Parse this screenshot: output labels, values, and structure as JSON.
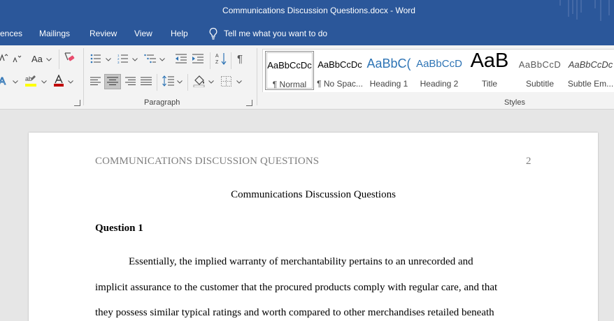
{
  "window": {
    "title": "Communications Discussion Questions.docx  -  Word"
  },
  "tabs": {
    "references_partial": "ences",
    "mailings": "Mailings",
    "review": "Review",
    "view": "View",
    "help": "Help",
    "tell_me": "Tell me what you want to do"
  },
  "ribbon": {
    "font_group": {
      "change_case_label": "Aa"
    },
    "paragraph_group": {
      "label": "Paragraph"
    },
    "styles_group": {
      "label": "Styles",
      "items": [
        {
          "preview": "AaBbCcDc",
          "name": "¶ Normal",
          "selected": true
        },
        {
          "preview": "AaBbCcDc",
          "name": "¶ No Spac...",
          "selected": false
        },
        {
          "preview": "AaBbC(",
          "name": "Heading 1",
          "selected": false
        },
        {
          "preview": "AaBbCcD",
          "name": "Heading 2",
          "selected": false
        },
        {
          "preview": "AaB",
          "name": "Title",
          "selected": false
        },
        {
          "preview": "AaBbCcD",
          "name": "Subtitle",
          "selected": false
        },
        {
          "preview": "AaBbCcDc",
          "name": "Subtle Em...",
          "selected": false
        }
      ]
    }
  },
  "colors": {
    "word_blue": "#2b579a",
    "highlight_yellow": "#ffff00",
    "font_color_red": "#c00000",
    "heading_blue": "#2e74b5"
  },
  "document": {
    "header_text": "COMMUNICATIONS DISCUSSION QUESTIONS",
    "page_number": "2",
    "title": "Communications Discussion Questions",
    "question_heading": "Question 1",
    "paragraph_lines": [
      "Essentially, the implied warranty of merchantability pertains to an unrecorded and",
      "implicit assurance to the customer that the procured products comply with regular care, and that",
      "they possess similar typical ratings and worth compared to other merchandises retailed beneath"
    ]
  }
}
